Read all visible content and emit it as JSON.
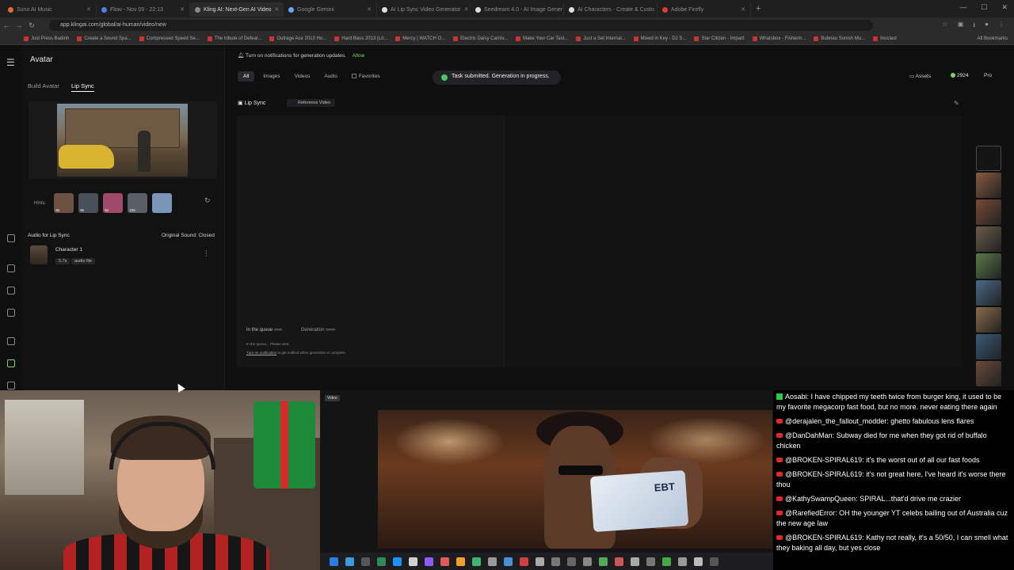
{
  "browser": {
    "tabs": [
      {
        "label": "Suno AI Music",
        "color": "#e56a2f"
      },
      {
        "label": "Flow - Nov 09 - 22:13",
        "color": "#4a7fe8"
      },
      {
        "label": "Kling AI: Next-Gen AI Video",
        "color": "#8a8a8a",
        "active": true
      },
      {
        "label": "Google Gemini",
        "color": "#6aa6ff"
      },
      {
        "label": "AI Lip Sync Video Generator",
        "color": "#dddddd"
      },
      {
        "label": "Seedream 4.0 - AI Image Gener",
        "color": "#dddddd"
      },
      {
        "label": "AI Characters - Create & Custo",
        "color": "#dddddd"
      },
      {
        "label": "Adobe Firefly",
        "color": "#e03a3a"
      }
    ],
    "url": "app.klingai.com/global/ai-human/video/new",
    "bookmarks": [
      "Just Press Badinh",
      "Create a Sound Spa...",
      "Compressed Speed Se...",
      "The tribute of Defeat...",
      "Outrage Ace 2013 Ho...",
      "Hard Bass 2013 (Lit...",
      "Mercy | WATCH O...",
      "Electric Daisy Carniv...",
      "Make Your Car Tast...",
      "Just a Set Internal...",
      "Mixed in Key - DJ S...",
      "Star Citizen - Impact",
      "Whatsbox - Fisherm...",
      "Bubnau Sonish Mu...",
      "Inoclast"
    ],
    "all_bookmarks": "All Bookmarks"
  },
  "app": {
    "title": "Avatar",
    "subtabs": {
      "build": "Build Avatar",
      "lipsync": "Lip Sync"
    },
    "hints_label": "Hints:",
    "hints": [
      {
        "duration": "8s",
        "color": "#6b5244"
      },
      {
        "duration": "8s",
        "color": "#4a4f5a"
      },
      {
        "duration": "5s",
        "color": "#a04a6a"
      },
      {
        "duration": "10s",
        "color": "#5a5f66"
      },
      {
        "duration": "",
        "color": "#7a95b5"
      }
    ],
    "audio_title": "Audio for Lip Sync",
    "original_sound": "Original Sound: Closed",
    "character": {
      "name": "Character 1",
      "duration": "5.7s",
      "type": "audio file"
    },
    "notification": "Turn on notifications for generation updates.",
    "allow": "Allow",
    "filter_tabs": [
      "All",
      "Images",
      "Videos",
      "Audio"
    ],
    "favorites": "Favorites",
    "toast": "Task submitted. Generation in progress.",
    "assets": "Assets",
    "credits": "2924",
    "pro": "Pro",
    "lipsync_label": "Lip Sync",
    "reference_video": "Reference Video",
    "queue": {
      "in_queue": "In the queue",
      "generation": "Generation",
      "note": "In the queue... Please wait.",
      "turn_on": "Turn on notification",
      "turn_on_rest": " to get notified when generation is complete."
    },
    "history_thumbs": [
      "#8a5a40",
      "#7a4a36",
      "#6a5a4a",
      "#5a7a4a",
      "#4a6a8a",
      "#8a6a4a",
      "#3a5a7a",
      "#6a4a3a",
      "#5a5a6a",
      "#7a6a5a",
      "#8a4a4a"
    ]
  },
  "stream": {
    "video_label": "Video",
    "card_text": "EBT",
    "chat": [
      {
        "platform": "twitch",
        "user": "Aosabi",
        "text": "I have chipped my teeth twice from burger king, it used to be my favorite megacorp fast food, but no more. never eating there again"
      },
      {
        "platform": "youtube",
        "user": "@derajalen_the_fallout_modder",
        "text": "ghetto fabulous lens flares"
      },
      {
        "platform": "youtube",
        "user": "@DanDahMan",
        "text": "Subway died for me when they got rid of buffalo chicken"
      },
      {
        "platform": "youtube",
        "user": "@BROKEN-SPIRAL619",
        "text": "it's the worst out of all our fast foods"
      },
      {
        "platform": "youtube",
        "user": "@BROKEN-SPIRAL619",
        "text": "it's not great here, I've heard it's worse there thou"
      },
      {
        "platform": "youtube",
        "user": "@KathySwampQueen",
        "text": "SPIRAL...that'd drive me crazier"
      },
      {
        "platform": "youtube",
        "user": "@RarefiedError",
        "text": "OH the younger YT celebs bailing out of Australia cuz the new age law"
      },
      {
        "platform": "youtube",
        "user": "@BROKEN-SPIRAL619",
        "text": "Kathy not really, it's a 50/50, I can smell what they baking all day, but yes close"
      }
    ]
  }
}
